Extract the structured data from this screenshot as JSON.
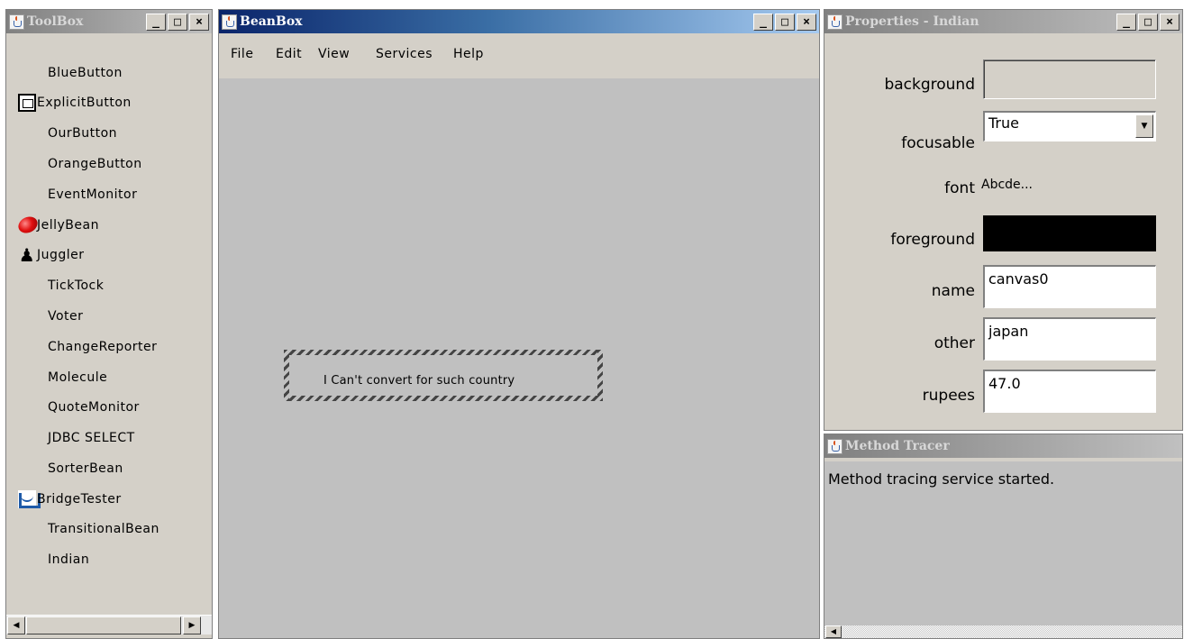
{
  "toolbox": {
    "title": "ToolBox",
    "controls": [
      "_",
      "□",
      "×"
    ],
    "items": [
      {
        "label": "BlueButton",
        "icon": ""
      },
      {
        "label": "ExplicitButton",
        "icon": "explicit-button-icon"
      },
      {
        "label": "OurButton",
        "icon": ""
      },
      {
        "label": "OrangeButton",
        "icon": ""
      },
      {
        "label": "EventMonitor",
        "icon": ""
      },
      {
        "label": "JellyBean",
        "icon": "jellybean-icon"
      },
      {
        "label": "Juggler",
        "icon": "juggler-icon"
      },
      {
        "label": "TickTock",
        "icon": ""
      },
      {
        "label": "Voter",
        "icon": ""
      },
      {
        "label": "ChangeReporter",
        "icon": ""
      },
      {
        "label": "Molecule",
        "icon": ""
      },
      {
        "label": "QuoteMonitor",
        "icon": ""
      },
      {
        "label": "JDBC SELECT",
        "icon": ""
      },
      {
        "label": "SorterBean",
        "icon": ""
      },
      {
        "label": "BridgeTester",
        "icon": "bridge-icon"
      },
      {
        "label": "TransitionalBean",
        "icon": ""
      },
      {
        "label": "Indian",
        "icon": ""
      }
    ],
    "scroll_left": "◀",
    "scroll_right": "▶"
  },
  "beanbox": {
    "title": "BeanBox",
    "menu": [
      "File",
      "Edit",
      "View",
      "Services",
      "Help"
    ],
    "bean_text": "I Can't convert for such country"
  },
  "properties": {
    "title": "Properties - Indian",
    "rows": [
      {
        "label": "background",
        "type": "color",
        "value": ""
      },
      {
        "label": "focusable",
        "type": "select",
        "value": "True"
      },
      {
        "label": "font",
        "type": "font",
        "value": "Abcde..."
      },
      {
        "label": "foreground",
        "type": "color",
        "value": ""
      },
      {
        "label": "name",
        "type": "text",
        "value": "canvas0"
      },
      {
        "label": "other",
        "type": "text",
        "value": "japan"
      },
      {
        "label": "rupees",
        "type": "text",
        "value": "47.0"
      }
    ],
    "colors": {
      "background": "#d4d0c8",
      "foreground": "#000000"
    }
  },
  "tracer": {
    "title": "Method Tracer",
    "message": "Method tracing service started."
  },
  "theme": {
    "active_title": "#0a246a",
    "inactive_title": "#808080",
    "window_face": "#d4d0c8",
    "canvas": "#c0c0c0"
  }
}
